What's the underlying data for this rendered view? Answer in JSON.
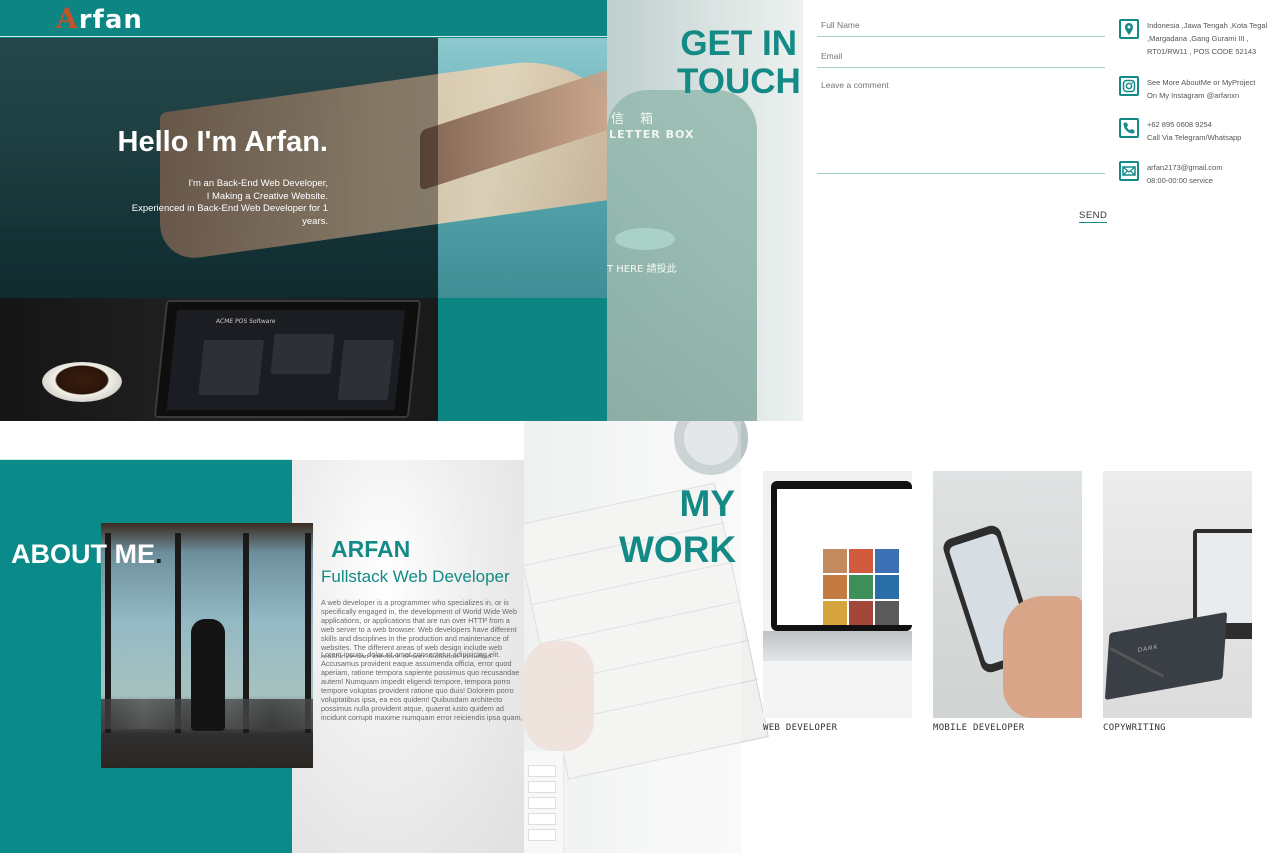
{
  "hero": {
    "logo_first": "A",
    "logo_rest": "rfan",
    "heading": "Hello I'm Arfan.",
    "intro_lines": [
      "I'm an Back-End Web Developer,",
      "I Making a Creative Website.",
      "Experienced in Back-End Web Developer for 1",
      "years."
    ],
    "laptop_window_title": "ACME POS Software"
  },
  "contact": {
    "heading_line1": "GET IN",
    "heading_line2": "TOUCH",
    "postbox_label_cn": "信 箱",
    "postbox_label": "LETTER BOX",
    "postbox_here": "T HERE 請投此",
    "form": {
      "name_placeholder": "Full Name",
      "email_placeholder": "Email",
      "comment_placeholder": "Leave a comment",
      "send_label": "SEND"
    },
    "info": [
      {
        "icon": "location-icon",
        "lines": [
          "Indonesia ,Jawa Tengah ,Kota Tegal",
          ",Margadana ,Gang Gurami III ,",
          "RT01/RW11 , POS CODE 52143"
        ]
      },
      {
        "icon": "instagram-icon",
        "lines": [
          "See More AboutMe or MyProject",
          "On My Instagram @arfanxn"
        ]
      },
      {
        "icon": "phone-icon",
        "lines": [
          "+62 895 0608 9254",
          "Call Via Telegram/Whatsapp"
        ]
      },
      {
        "icon": "mail-icon",
        "lines": [
          "arfan2173@gmail.com",
          "08:00-00:00 service"
        ]
      }
    ],
    "colors": {
      "accent": "#138a86"
    }
  },
  "about": {
    "heading": "ABOUT ME",
    "heading_dot": ".",
    "name": "ARFAN",
    "role": "Fullstack Web Developer",
    "paragraph1": "A web developer is a programmer who specializes in, or is specifically engaged in, the development of World Wide Web applications, or applications that are run over HTTP from a web server to a web browser. Web developers have different skills and disciplines in the production and maintenance of websites. The different areas of web design include web graphic design; interface design; authoring, including standardised code and proprietary software; user experience design; and search engine optimization. Often many individuals will work in teams covering different aspects of the design process, although some designers will cover them all.",
    "paragraph2": "Lorem ipsum, dolor sit amet consectetur adipisicing elit. Accusamus provident eaque assumenda officia, error quod aperiam, ratione tempora sapiente possimus quo recusandae autem! Numquam impedit eligendi tempore, tempora porro tempore voluptas provident ratione quo duis! Dolorem porro voluptatibus ipsa, ea eos quidem! Quibusdam architecto possimus nulla provident atque, quaerat iusto quidem ad incidunt corrupti maxime numquam error reiciendis ipsa quam, dolores accusamus, vero a quia porro maiores! Asperiores amet tenetur adipisci eligendi omnis alias modi reiciendis similique, quas voluptates itaque optio, sint quidem in, reiciendis amet saepe. Quaerat, nam quia officia, molestiae sed enim soluta pariatur deleniti labore, fugit eligendi, quas eius ea dolorem dolores, ab nulla pariatur deleniti labore, fugit eligendi nihil eum error illum distinctio. Rerum tenetur impedit rem, harum."
  },
  "work": {
    "heading_line1": "MY",
    "heading_line2": "WORK",
    "items": [
      {
        "label": "WEB DEVELOPER"
      },
      {
        "label": "MOBILE DEVELOPER"
      },
      {
        "label": "COPYWRITING",
        "notebook_text": "DARK"
      }
    ]
  }
}
